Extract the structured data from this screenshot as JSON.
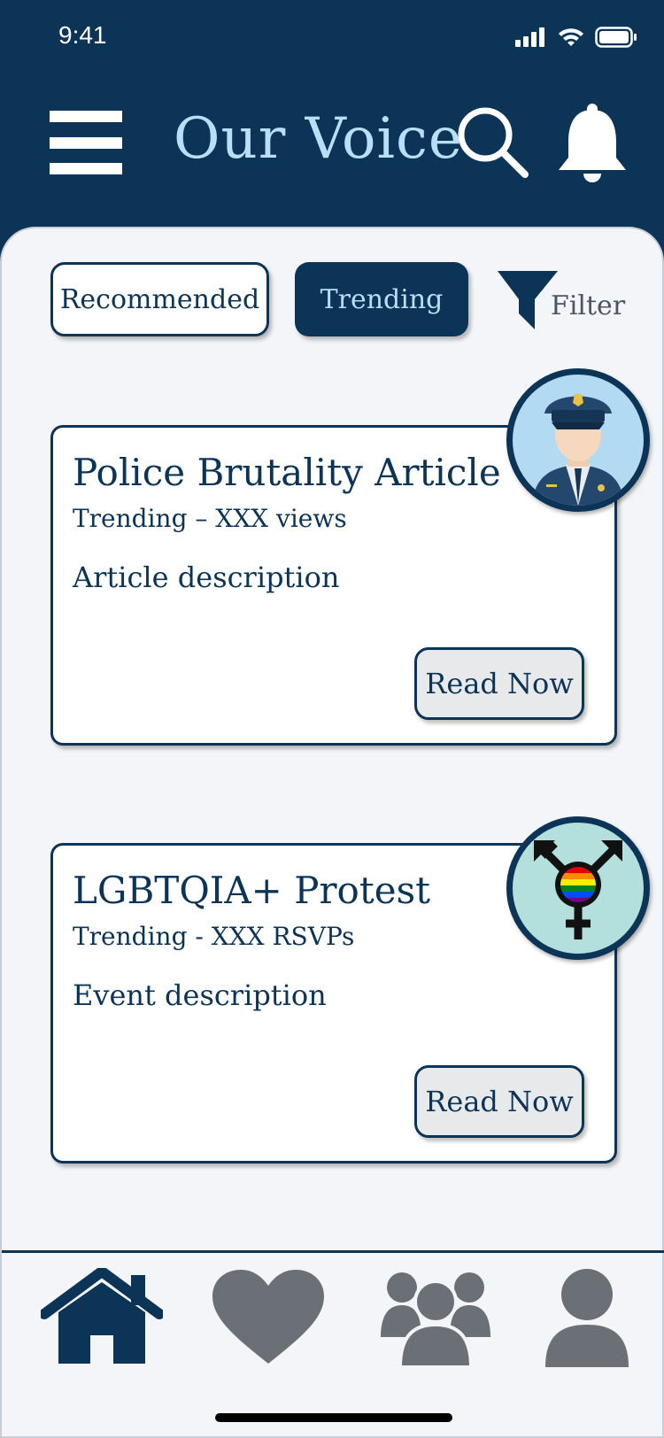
{
  "status_bar": {
    "time": "9:41",
    "icons": [
      "signal-icon",
      "wifi-icon",
      "battery-icon"
    ]
  },
  "header": {
    "title": "Our Voice",
    "icons": [
      "menu-icon",
      "search-icon",
      "bell-icon"
    ]
  },
  "tabs": [
    {
      "label": "Recommended",
      "selected": false
    },
    {
      "label": "Trending",
      "selected": true
    }
  ],
  "filter": {
    "label": "Filter",
    "icon": "filter-icon"
  },
  "cards": [
    {
      "title": "Police Brutality Article",
      "meta": "Trending – XXX views",
      "description": "Article description",
      "button": "Read Now",
      "avatar_icon": "police-officer-icon"
    },
    {
      "title": "LGBTQIA+ Protest",
      "meta": "Trending - XXX RSVPs",
      "description": "Event description",
      "button": "Read Now",
      "avatar_icon": "transgender-pride-icon"
    }
  ],
  "bottom_nav": {
    "items": [
      "home-icon",
      "heart-icon",
      "community-icon",
      "profile-icon"
    ],
    "active": "home-icon"
  },
  "colors": {
    "primary": "#0c3457",
    "accent": "#b9def7",
    "background": "#f3f5f8",
    "inactive_nav": "#6b7077"
  }
}
